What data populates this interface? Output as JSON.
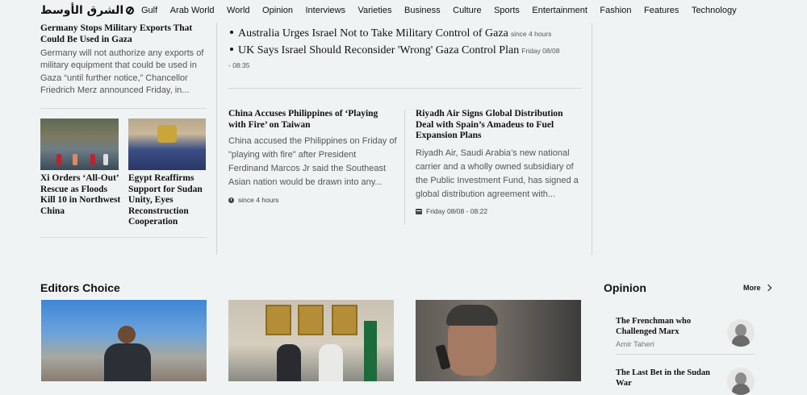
{
  "nav": {
    "logo": "الشرق الأوسط",
    "items": [
      "Gulf",
      "Arab World",
      "World",
      "Opinion",
      "Interviews",
      "Varieties",
      "Business",
      "Culture",
      "Sports",
      "Entertainment",
      "Fashion",
      "Features",
      "Technology"
    ]
  },
  "left": {
    "top_story": {
      "title": "Germany Stops Military Exports That Could Be Used in Gaza",
      "summary": "Germany will not authorize any exports of military equipment that could be used in Gaza “until further notice,” Chancellor Friedrich Merz announced Friday, in..."
    },
    "small_stories": [
      {
        "title": "Xi Orders ‘All-Out’ Rescue as Floods Kill 10 in Northwest China"
      },
      {
        "title": "Egypt Reaffirms Support for Sudan Unity, Eyes Reconstruction Cooperation"
      }
    ]
  },
  "middle": {
    "bullets": [
      {
        "title": "Australia Urges Israel Not to Take Military Control of Gaza",
        "time": "since 4 hours"
      },
      {
        "title": "UK Says Israel Should Reconsider 'Wrong' Gaza Control Plan",
        "time": "Friday 08/08 - 08:35"
      }
    ],
    "articles": [
      {
        "title": "China Accuses Philippines of ‘Playing with Fire’ on Taiwan",
        "summary": "China accused the Philippines on Friday of \"playing with fire\" after President Ferdinand Marcos Jr said the Southeast Asian nation would be drawn into any...",
        "time": "since 4 hours"
      },
      {
        "title": "Riyadh Air Signs Global Distribution Deal with Spain’s Amadeus to Fuel Expansion Plans",
        "summary": "Riyadh Air, Saudi Arabia’s new national carrier and a wholly owned subsidiary of the Public Investment Fund, has signed a global distribution agreement with...",
        "time": "Friday 08/08 - 08:22"
      }
    ]
  },
  "editors_choice": {
    "title": "Editors Choice"
  },
  "opinion": {
    "title": "Opinion",
    "more": "More",
    "items": [
      {
        "title": "The Frenchman who Challenged Marx",
        "author": "Amir Taheri"
      },
      {
        "title": "The Last Bet in the Sudan War"
      }
    ]
  }
}
